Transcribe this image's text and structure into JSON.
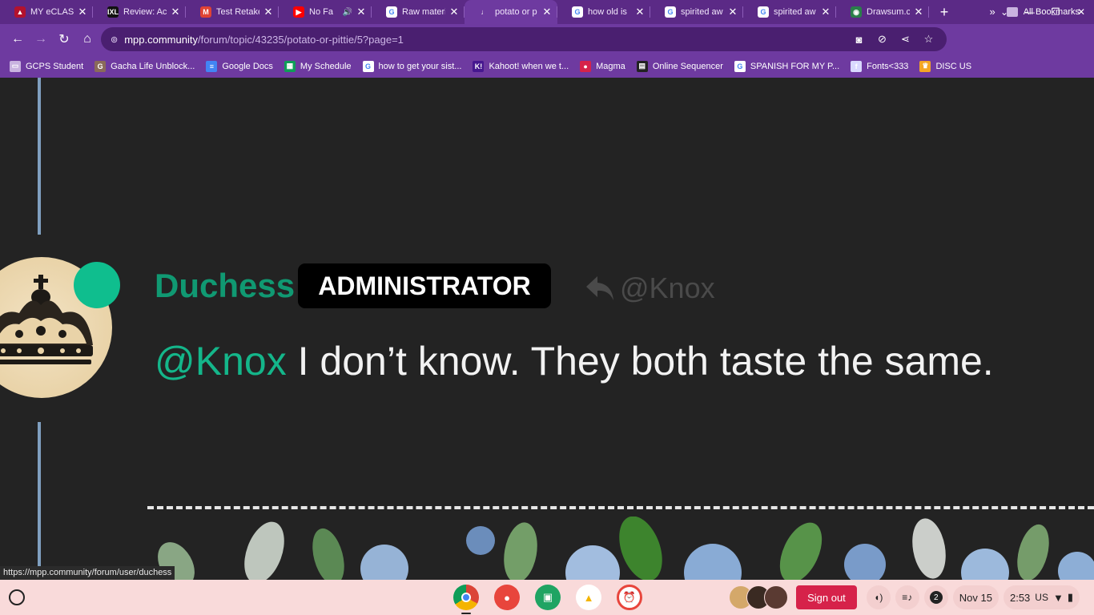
{
  "tabs": [
    {
      "title": "MY eCLASS",
      "icon": "eclass-icon",
      "color": "#b3122e",
      "glyph": "▲"
    },
    {
      "title": "Review: Act",
      "icon": "ixl-icon",
      "color": "#111111",
      "glyph": "IXL"
    },
    {
      "title": "Test Retake",
      "icon": "gmail-icon",
      "color": "#e04334",
      "glyph": "M"
    },
    {
      "title": "No Fa",
      "icon": "youtube-icon",
      "color": "#ff0000",
      "glyph": "▶",
      "audio": "🔊"
    },
    {
      "title": "Raw materi",
      "icon": "google-icon",
      "color": "#ffffff",
      "glyph": "G"
    },
    {
      "title": "potato or p",
      "icon": "mpp-icon",
      "color": "#6e3aa0",
      "glyph": "♩",
      "active": true
    },
    {
      "title": "how old is",
      "icon": "google-icon",
      "color": "#ffffff",
      "glyph": "G"
    },
    {
      "title": "spirited aw",
      "icon": "google-icon",
      "color": "#ffffff",
      "glyph": "G"
    },
    {
      "title": "spirited aw",
      "icon": "google-icon",
      "color": "#ffffff",
      "glyph": "G"
    },
    {
      "title": "Drawsum.c",
      "icon": "drawsum-icon",
      "color": "#2a7f4a",
      "glyph": "◉"
    }
  ],
  "address": {
    "host": "mpp.community",
    "path": "/forum/topic/43235/potato-or-pittie/5?page=1"
  },
  "bookmarks": [
    {
      "label": "GCPS Student",
      "icon": "folder-icon",
      "color": "#c9b3e0",
      "glyph": "▭"
    },
    {
      "label": "Gacha Life Unblock...",
      "icon": "gacha-icon",
      "color": "#8a6a5a",
      "glyph": "G"
    },
    {
      "label": "Google Docs",
      "icon": "docs-icon",
      "color": "#4285f4",
      "glyph": "≡"
    },
    {
      "label": "My Schedule",
      "icon": "sheets-icon",
      "color": "#0f9d58",
      "glyph": "▦"
    },
    {
      "label": "how to get your sist...",
      "icon": "google-icon",
      "color": "#ffffff",
      "glyph": "G"
    },
    {
      "label": "Kahoot! when we t...",
      "icon": "kahoot-icon",
      "color": "#46178f",
      "glyph": "K!"
    },
    {
      "label": "Magma",
      "icon": "magma-icon",
      "color": "#d6224a",
      "glyph": "●"
    },
    {
      "label": "Online Sequencer",
      "icon": "sequencer-icon",
      "color": "#222222",
      "glyph": "▤"
    },
    {
      "label": "SPANISH FOR MY P...",
      "icon": "google-icon",
      "color": "#ffffff",
      "glyph": "G"
    },
    {
      "label": "Fonts<333",
      "icon": "fonts-icon",
      "color": "#d9d9ff",
      "glyph": "f"
    },
    {
      "label": "DISC US",
      "icon": "crown-icon",
      "color": "#f5a623",
      "glyph": "♛"
    }
  ],
  "all_bookmarks": "All Bookmarks",
  "post": {
    "author": "Duchess",
    "role": "ADMINISTRATOR",
    "reply_to": "@Knox",
    "mention": "@Knox",
    "text": " I don’t know. They both taste the same."
  },
  "status_url": "https://mpp.community/forum/user/duchess",
  "shelf": {
    "sign_out": "Sign out",
    "notification_count": "2",
    "date": "Nov 15",
    "time": "2:53",
    "locale": "US"
  },
  "colors": {
    "accent_green": "#109972",
    "online_dot": "#0fbe8e",
    "browser_purple": "#6e3aa0",
    "sign_out_red": "#d6224a"
  }
}
